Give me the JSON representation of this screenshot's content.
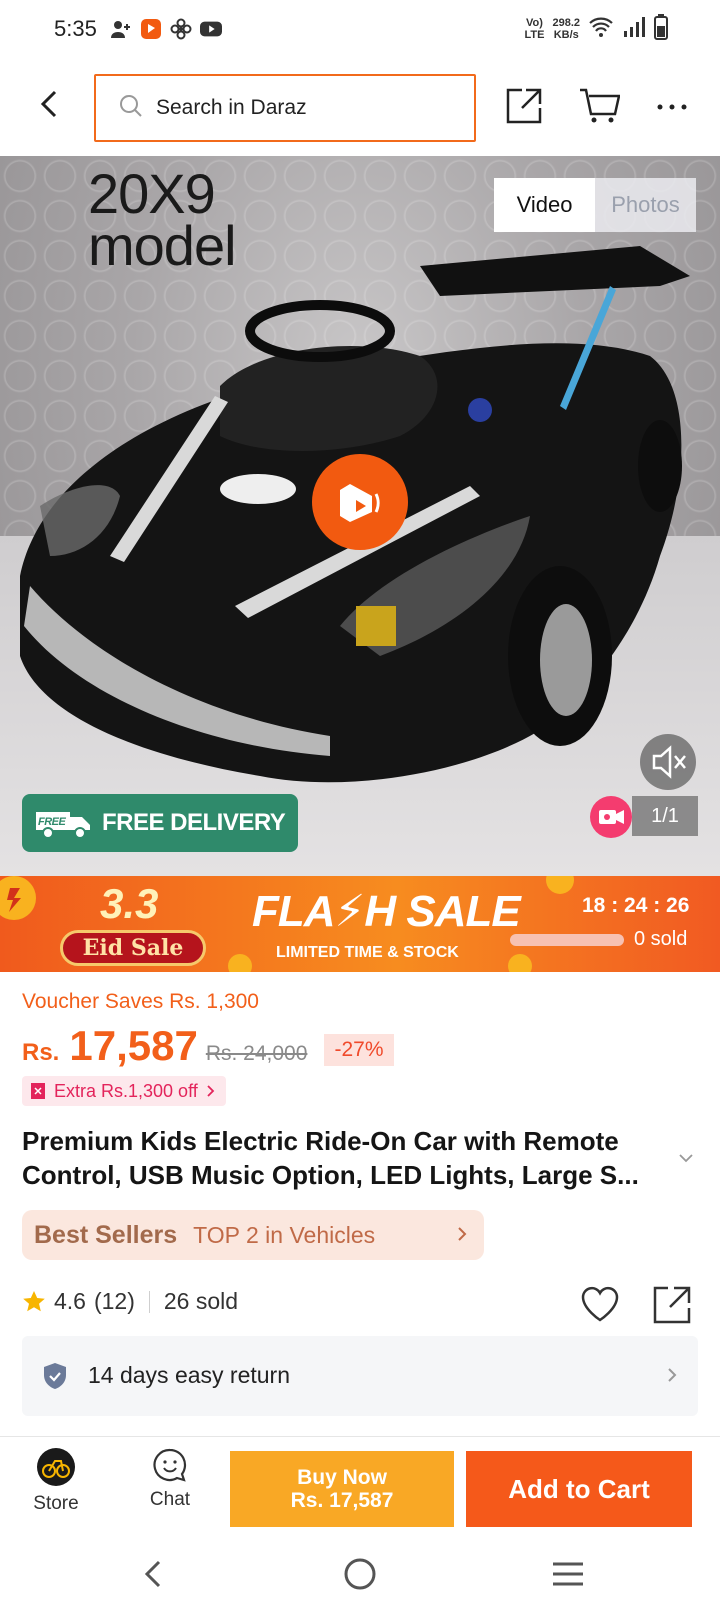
{
  "status_bar": {
    "time": "5:35",
    "network_type_top": "Vo)",
    "network_type_bottom": "LTE",
    "speed_value": "298.2",
    "speed_unit": "KB/s"
  },
  "header": {
    "search_placeholder": "Search in Daraz"
  },
  "hero": {
    "overlay_text_line1": "20X9",
    "overlay_text_line2": "model",
    "tab_video": "Video",
    "tab_photos": "Photos",
    "free_delivery_badge": "FREE",
    "free_delivery_label": "FREE DELIVERY",
    "pager": "1/1"
  },
  "flash_sale": {
    "event_number": "3.3",
    "event_name": "Eid Sale",
    "title": "FLA⚡H SALE",
    "subtitle": "LIMITED TIME & STOCK",
    "timer": "18 : 24 : 26",
    "sold": "0 sold",
    "sold_fraction": 0
  },
  "price": {
    "voucher": "Voucher Saves Rs. 1,300",
    "currency": "Rs.",
    "current": "17,587",
    "original": "Rs. 24,000",
    "discount": "-27%",
    "extra_off": "Extra Rs.1,300 off"
  },
  "product": {
    "title": "Premium Kids Electric Ride-On Car with Remote Control, USB Music Option, LED Lights, Large S..."
  },
  "best_sellers": {
    "label": "Best Sellers",
    "rank": "TOP 2 in Vehicles"
  },
  "rating": {
    "score": "4.6",
    "count": "(12)",
    "sold": "26 sold"
  },
  "returns": {
    "label": "14 days easy return"
  },
  "actions": {
    "store": "Store",
    "chat": "Chat",
    "buy_now_line1": "Buy Now",
    "buy_now_line2": "Rs. 17,587",
    "add_to_cart": "Add to Cart"
  },
  "colors": {
    "brand_orange": "#f5591a",
    "buy_now": "#f9a825",
    "free_delivery": "#2f8a6b"
  }
}
